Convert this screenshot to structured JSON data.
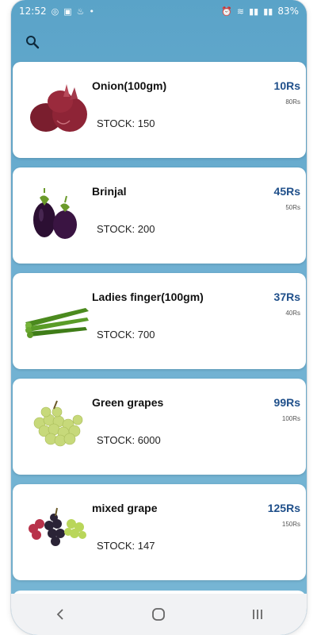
{
  "status_bar": {
    "time": "12:52",
    "battery": "83%"
  },
  "toolbar": {
    "search_icon": "search-icon"
  },
  "products": [
    {
      "name": "Onion(100gm)",
      "stock": "STOCK: 150",
      "price": "10Rs",
      "mrp": "80Rs",
      "image": "onion-image"
    },
    {
      "name": "Brinjal",
      "stock": "STOCK: 200",
      "price": "45Rs",
      "mrp": "50Rs",
      "image": "brinjal-image"
    },
    {
      "name": "Ladies finger(100gm)",
      "stock": "STOCK: 700",
      "price": "37Rs",
      "mrp": "40Rs",
      "image": "okra-image"
    },
    {
      "name": "Green grapes",
      "stock": "STOCK: 6000",
      "price": "99Rs",
      "mrp": "100Rs",
      "image": "green-grapes-image"
    },
    {
      "name": "mixed grape",
      "stock": "STOCK: 147",
      "price": "125Rs",
      "mrp": "150Rs",
      "image": "mixed-grape-image"
    }
  ],
  "nav": {
    "back_icon": "back-icon",
    "home_icon": "home-icon",
    "recents_icon": "recents-icon"
  },
  "colors": {
    "header_gradient_top": "#5aa3c8",
    "price": "#1f4f8a",
    "card_background": "#ffffff"
  }
}
